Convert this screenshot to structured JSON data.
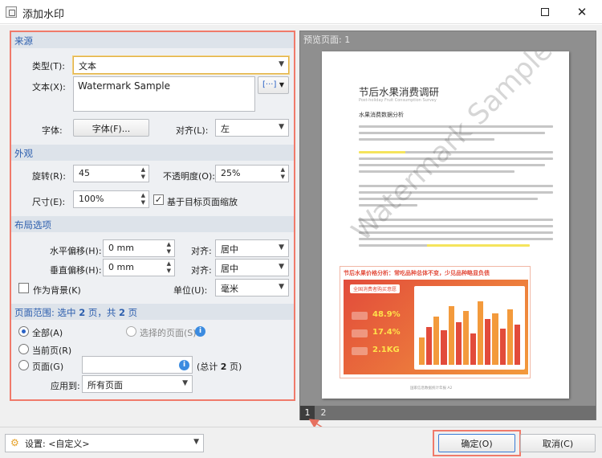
{
  "window": {
    "title": "添加水印",
    "minimize_icon": "minimize-icon",
    "close_icon": "close-icon"
  },
  "source": {
    "header": "来源",
    "type_label": "类型(T):",
    "type_value": "文本",
    "text_label": "文本(X):",
    "text_value": "Watermark Sample",
    "insert_icon": "insert-field-icon",
    "font_label": "字体:",
    "font_button": "字体(F)...",
    "align_label": "对齐(L):",
    "align_value": "左"
  },
  "appearance": {
    "header": "外观",
    "rotation_label": "旋转(R):",
    "rotation_value": "45",
    "opacity_label": "不透明度(O):",
    "opacity_value": "25%",
    "size_label": "尺寸(E):",
    "size_value": "100%",
    "scale_check": "✓",
    "scale_label": "基于目标页面缩放"
  },
  "layout": {
    "header": "布局选项",
    "h_offset_label": "水平偏移(H):",
    "h_offset_value": "0 mm",
    "h_align_label": "对齐:",
    "h_align_value": "居中",
    "v_offset_label": "垂直偏移(H):",
    "v_offset_value": "0 mm",
    "v_align_label": "对齐:",
    "v_align_value": "居中",
    "background_label": "作为背景(K)",
    "unit_label": "单位(U):",
    "unit_value": "毫米"
  },
  "range": {
    "header_prefix": "页面范围: 选中 ",
    "selected_count": "2",
    "header_mid": " 页，共 ",
    "total_count": "2",
    "header_suffix": " 页",
    "all_label": "全部(A)",
    "selected_label": "选择的页面(S)",
    "current_label": "当前页(R)",
    "pages_label": "页面(G)",
    "pages_value": "",
    "total_prefix": "(总计 ",
    "total_value": "2",
    "total_suffix": " 页)",
    "apply_label": "应用到:",
    "apply_value": "所有页面"
  },
  "preview": {
    "header": "预览页面: 1",
    "pages": [
      "1",
      "2"
    ],
    "selected_page": "1",
    "watermark": "Watermark Sample",
    "doc": {
      "title": "节后水果消费调研",
      "subtitle": "Post-holiday Fruit Consumption Survey",
      "section": "水果消费数据分析",
      "chart_title": "节后水果价格分析：常吃品种总体不变，少见品种略显负债",
      "chart_badge": "全国消费者购买意愿",
      "stats": [
        "48.9%",
        "17.4%",
        "2.1KG"
      ],
      "footer": "国家信息数据统计年报 A2"
    }
  },
  "footer": {
    "settings_label": "设置: <自定义>",
    "ok_label": "确定(O)",
    "cancel_label": "取消(C)"
  },
  "colors": {
    "accent": "#2d5fae",
    "highlight_border": "#f07a6a",
    "arrow": "#e6705f",
    "chart_red": "#e24b3b",
    "chart_orange": "#f39a3c"
  }
}
